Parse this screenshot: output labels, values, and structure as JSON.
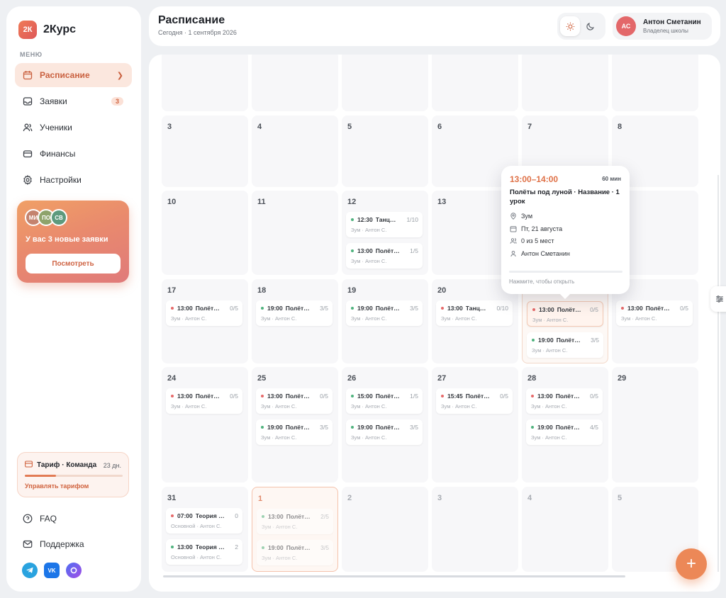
{
  "app": {
    "logo_mark": "2К",
    "name": "2Курс"
  },
  "sidebar": {
    "menu_title": "МЕНЮ",
    "items": [
      {
        "label": "Расписание",
        "icon": "calendar-icon",
        "active": true
      },
      {
        "label": "Заявки",
        "icon": "inbox-icon",
        "badge": "3"
      },
      {
        "label": "Ученики",
        "icon": "users-icon"
      },
      {
        "label": "Финансы",
        "icon": "wallet-icon"
      },
      {
        "label": "Настройки",
        "icon": "gear-icon"
      }
    ],
    "promo": {
      "avatars": [
        "МИ",
        "ПО",
        "СВ"
      ],
      "text": "У вас 3 новые заявки",
      "button": "Посмотреть"
    },
    "tariff": {
      "name": "Тариф · Команда",
      "days": "23 дн.",
      "progress": 0.32,
      "link": "Управлять тарифом"
    },
    "bottom_items": [
      {
        "label": "FAQ",
        "icon": "help-circle-icon"
      },
      {
        "label": "Поддержка",
        "icon": "mail-icon"
      }
    ],
    "socials": [
      "telegram-icon",
      "vk-icon",
      "max-icon"
    ]
  },
  "header": {
    "title": "Расписание",
    "subtitle": "Сегодня · 1 сентября 2026",
    "user": {
      "initials": "АС",
      "name": "Антон Сметанин",
      "role": "Владелец школы"
    }
  },
  "calendar": {
    "weeks": [
      {
        "days": [
          {
            "d": ""
          },
          {
            "d": ""
          },
          {
            "d": ""
          },
          {
            "d": ""
          },
          {
            "d": ""
          },
          {
            "d": ""
          }
        ]
      },
      {
        "days": [
          {
            "d": "3"
          },
          {
            "d": "4"
          },
          {
            "d": "5"
          },
          {
            "d": "6"
          },
          {
            "d": "7"
          },
          {
            "d": "8"
          }
        ]
      },
      {
        "days": [
          {
            "d": "10"
          },
          {
            "d": "11"
          },
          {
            "d": "12",
            "events": [
              {
                "time": "12:30",
                "title": "Танц…",
                "count": "1/10",
                "sub": "Зум · Антон С.",
                "dot": "#4fb37e"
              },
              {
                "time": "13:00",
                "title": "Полёт…",
                "count": "1/5",
                "sub": "Зум · Антон С.",
                "dot": "#4fb37e"
              }
            ]
          },
          {
            "d": "13"
          },
          {
            "d": ""
          },
          {
            "d": ""
          }
        ]
      },
      {
        "days": [
          {
            "d": "17",
            "events": [
              {
                "time": "13:00",
                "title": "Полёт…",
                "count": "0/5",
                "sub": "Зум · Антон С.",
                "dot": "#e66a6a"
              }
            ]
          },
          {
            "d": "18",
            "events": [
              {
                "time": "19:00",
                "title": "Полёт…",
                "count": "3/5",
                "sub": "Зум · Антон С.",
                "dot": "#4fb37e"
              }
            ]
          },
          {
            "d": "19",
            "events": [
              {
                "time": "19:00",
                "title": "Полёт…",
                "count": "3/5",
                "sub": "Зум · Антон С.",
                "dot": "#4fb37e"
              }
            ]
          },
          {
            "d": "20",
            "events": [
              {
                "time": "13:00",
                "title": "Танц…",
                "count": "0/10",
                "sub": "Зум · Антон С.",
                "dot": "#e66a6a"
              }
            ]
          },
          {
            "d": "",
            "events": [
              {
                "time": "13:00",
                "title": "Полёт…",
                "count": "0/5",
                "sub": "Зум · Антон С.",
                "dot": "#e66a6a",
                "selected": true
              },
              {
                "time": "19:00",
                "title": "Полёт…",
                "count": "3/5",
                "sub": "Зум · Антон С.",
                "dot": "#4fb37e"
              }
            ]
          },
          {
            "d": "",
            "events": [
              {
                "time": "13:00",
                "title": "Полёт…",
                "count": "0/5",
                "sub": "Зум · Антон С.",
                "dot": "#e66a6a"
              }
            ]
          }
        ]
      },
      {
        "days": [
          {
            "d": "24",
            "events": [
              {
                "time": "13:00",
                "title": "Полёт…",
                "count": "0/5",
                "sub": "Зум · Антон С.",
                "dot": "#e66a6a"
              }
            ]
          },
          {
            "d": "25",
            "events": [
              {
                "time": "13:00",
                "title": "Полёт…",
                "count": "0/5",
                "sub": "Зум · Антон С.",
                "dot": "#e66a6a"
              },
              {
                "time": "19:00",
                "title": "Полёт…",
                "count": "3/5",
                "sub": "Зум · Антон С.",
                "dot": "#4fb37e"
              }
            ]
          },
          {
            "d": "26",
            "events": [
              {
                "time": "15:00",
                "title": "Полёт…",
                "count": "1/5",
                "sub": "Зум · Антон С.",
                "dot": "#4fb37e"
              },
              {
                "time": "19:00",
                "title": "Полёт…",
                "count": "3/5",
                "sub": "Зум · Антон С.",
                "dot": "#4fb37e"
              }
            ]
          },
          {
            "d": "27",
            "events": [
              {
                "time": "15:45",
                "title": "Полёт…",
                "count": "0/5",
                "sub": "Зум · Антон С.",
                "dot": "#e66a6a"
              }
            ]
          },
          {
            "d": "28",
            "events": [
              {
                "time": "13:00",
                "title": "Полёт…",
                "count": "0/5",
                "sub": "Зум · Антон С.",
                "dot": "#e66a6a"
              },
              {
                "time": "19:00",
                "title": "Полёт…",
                "count": "4/5",
                "sub": "Зум · Антон С.",
                "dot": "#4fb37e"
              }
            ]
          },
          {
            "d": "29"
          }
        ]
      },
      {
        "days": [
          {
            "d": "31",
            "events": [
              {
                "time": "07:00",
                "title": "Теория …",
                "count": "0",
                "sub": "Основной · Антон С.",
                "dot": "#e66a6a"
              },
              {
                "time": "13:00",
                "title": "Теория …",
                "count": "2",
                "sub": "Основной · Антон С.",
                "dot": "#4fb37e"
              }
            ]
          },
          {
            "d": "1",
            "today": true,
            "events": [
              {
                "time": "13:00",
                "title": "Полёт…",
                "count": "2/5",
                "sub": "Зум · Антон С.",
                "dot": "#4fb37e",
                "faded": true
              },
              {
                "time": "19:00",
                "title": "Полёт…",
                "count": "3/5",
                "sub": "Зум · Антон С.",
                "dot": "#4fb37e",
                "faded": true
              }
            ]
          },
          {
            "d": "2",
            "faded": true
          },
          {
            "d": "3",
            "faded": true
          },
          {
            "d": "4",
            "faded": true
          },
          {
            "d": "5",
            "faded": true
          }
        ]
      }
    ]
  },
  "tooltip": {
    "time": "13:00–14:00",
    "duration": "60 мин",
    "title": "Полёты под луной · Название · 1 урок",
    "location": "Зум",
    "date": "Пт, 21 августа",
    "seats": "0 из 5 мест",
    "teacher": "Антон Сметанин",
    "hint": "Нажмите, чтобы открыть"
  },
  "colors": {
    "accent": "#e27b54",
    "green_dot": "#4fb37e",
    "red_dot": "#e66a6a"
  }
}
